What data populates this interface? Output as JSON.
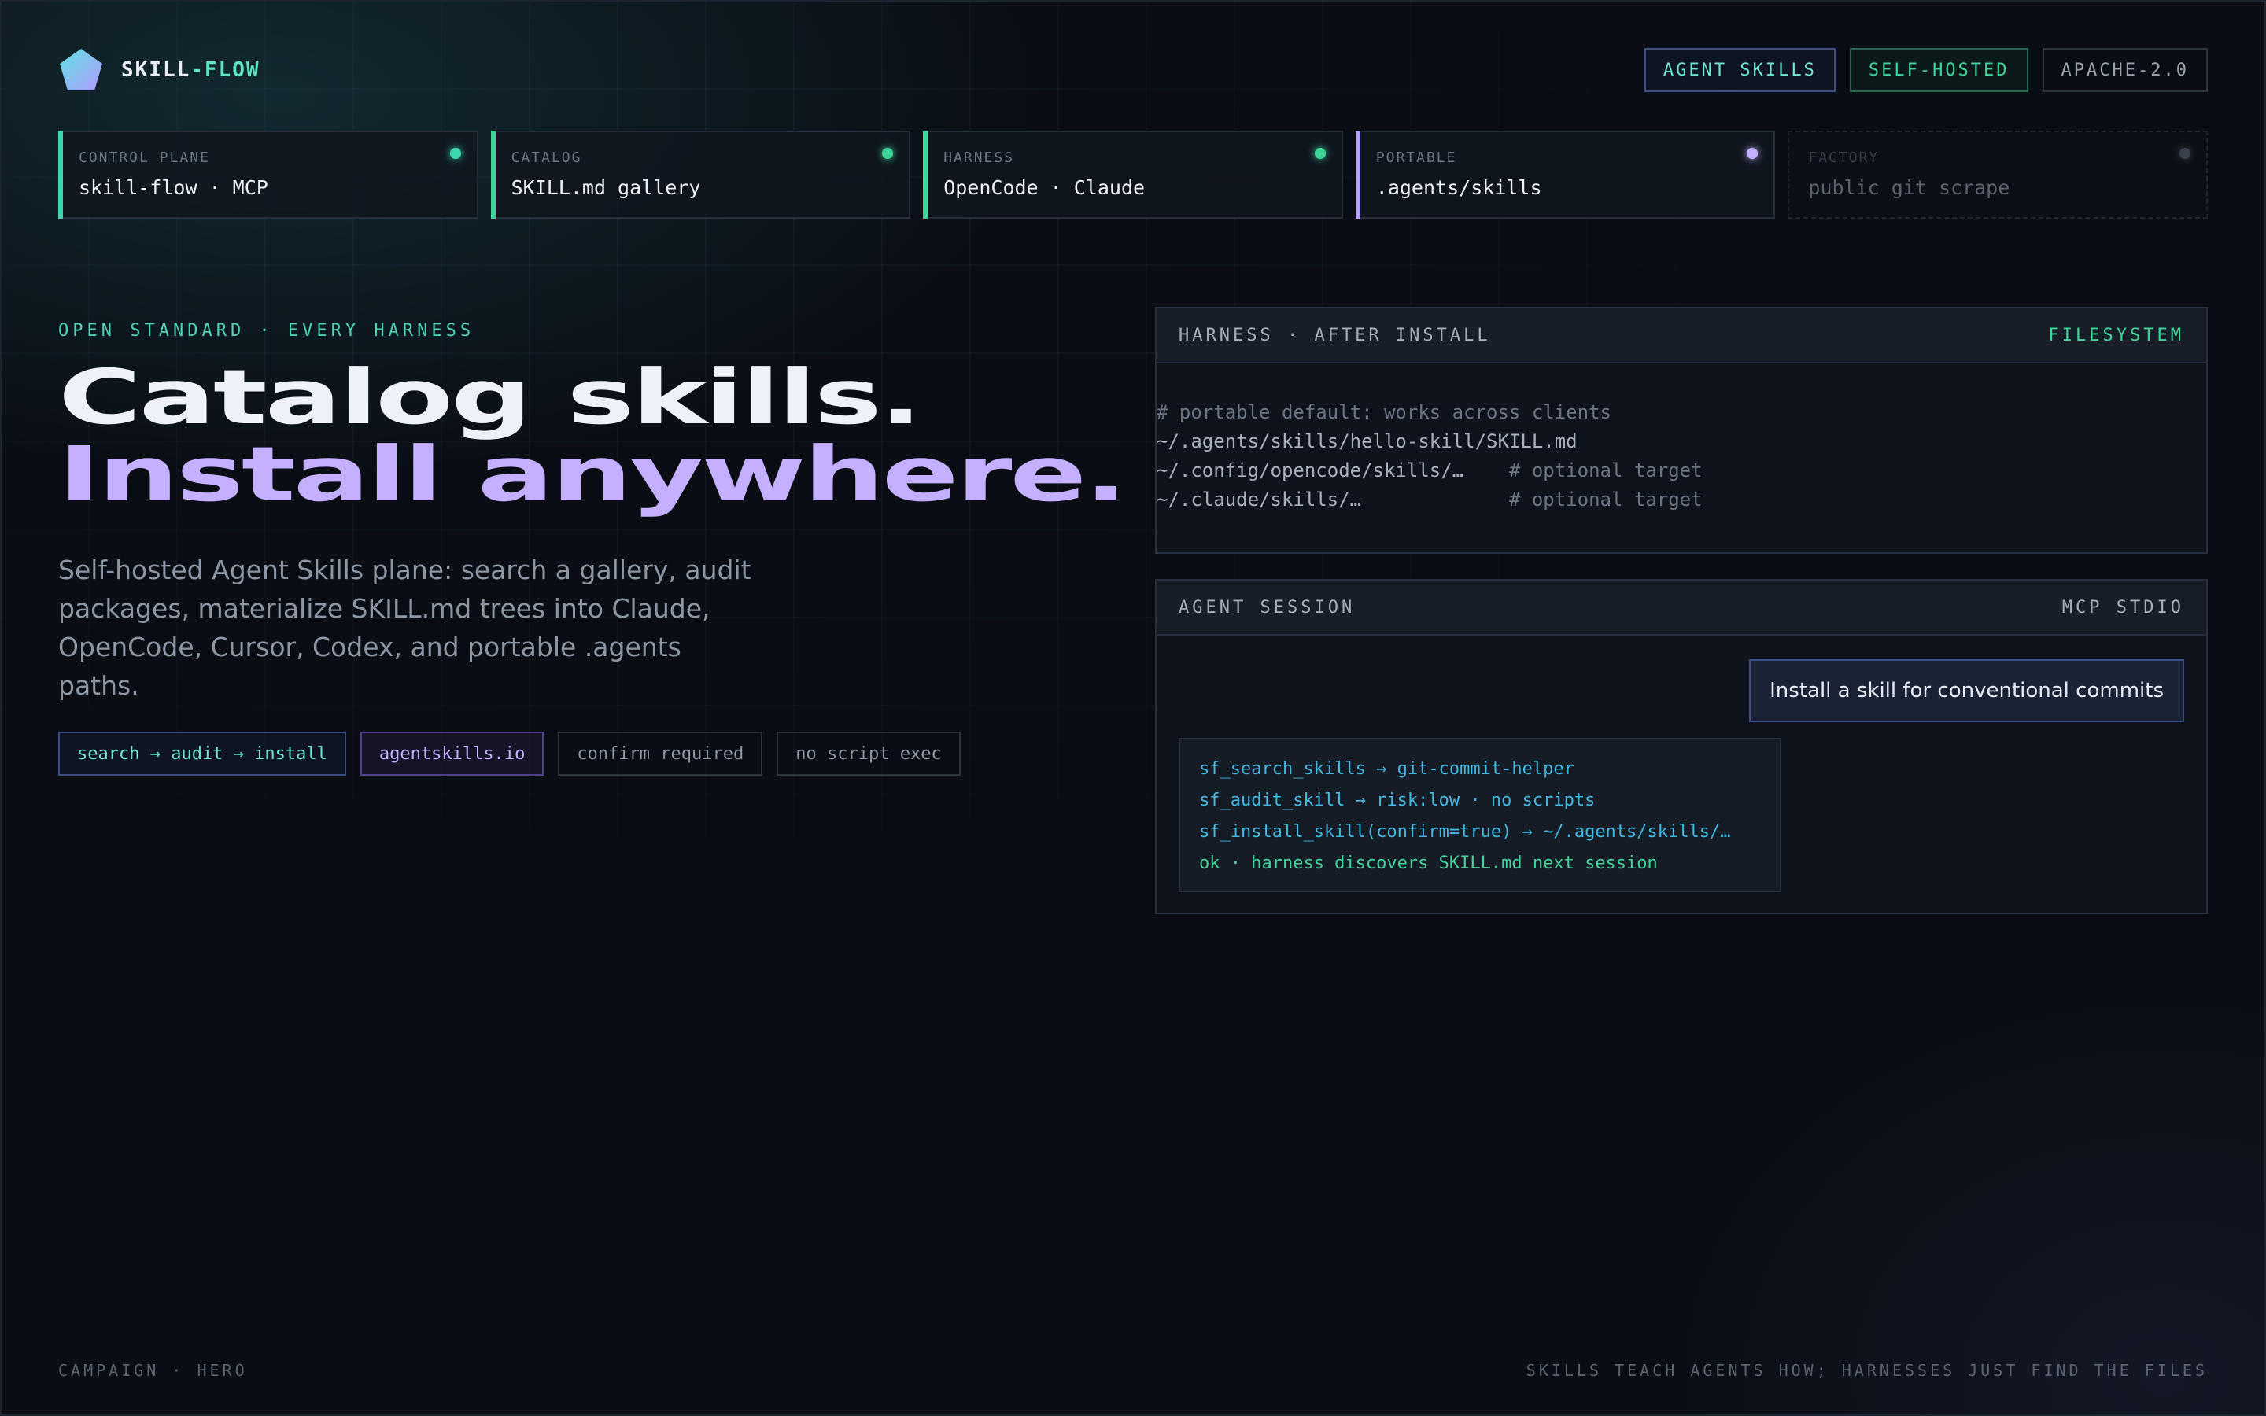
{
  "brand": {
    "name_a": "SKILL",
    "name_b": "-FLOW"
  },
  "badges": [
    "AGENT SKILLS",
    "SELF-HOSTED",
    "APACHE-2.0"
  ],
  "status_cards": [
    {
      "label": "CONTROL PLANE",
      "value": "skill-flow · MCP",
      "accent": "#3fd4b0",
      "dot": "#3fd4b0"
    },
    {
      "label": "CATALOG",
      "value": "SKILL.md gallery",
      "accent": "#3fd49a",
      "dot": "#3fd49a"
    },
    {
      "label": "HARNESS",
      "value": "OpenCode · Claude",
      "accent": "#3fd49a",
      "dot": "#3fd49a"
    },
    {
      "label": "PORTABLE",
      "value": ".agents/skills",
      "accent": "#b6a2ff",
      "dot": "#c4b0ff"
    },
    {
      "label": "FACTORY",
      "value": "public git scrape",
      "accent": "#2a313c",
      "dot": "#3a414c"
    }
  ],
  "hero": {
    "eyebrow": "OPEN STANDARD · EVERY HARNESS",
    "title_line1": "Catalog skills.",
    "title_line2": "Install anywhere.",
    "description": "Self-hosted Agent Skills plane: search a gallery, audit packages, materialize SKILL.md trees into Claude, OpenCode, Cursor, Codex, and portable .agents paths.",
    "chips": [
      "search → audit → install",
      "agentskills.io",
      "confirm required",
      "no script exec"
    ]
  },
  "harness_panel": {
    "title": "HARNESS · AFTER INSTALL",
    "tag": "FILESYSTEM",
    "comment": "# portable default: works across clients",
    "lines": [
      {
        "path": "~/.agents/skills/hello-skill/SKILL.md",
        "note": ""
      },
      {
        "path": "~/.config/opencode/skills/…",
        "note": "# optional target"
      },
      {
        "path": "~/.claude/skills/…",
        "note": "# optional target"
      }
    ]
  },
  "session_panel": {
    "title": "AGENT SESSION",
    "tag": "MCP STDIO",
    "user_message": "Install a skill for conventional commits",
    "tool_calls": [
      "sf_search_skills → git-commit-helper",
      "sf_audit_skill → risk:low · no scripts",
      "sf_install_skill(confirm=true) → ~/.agents/skills/…"
    ],
    "result": "ok · harness discovers SKILL.md next session"
  },
  "footer": {
    "left": "CAMPAIGN · HERO",
    "right": "SKILLS TEACH AGENTS HOW; HARNESSES JUST FIND THE FILES"
  }
}
